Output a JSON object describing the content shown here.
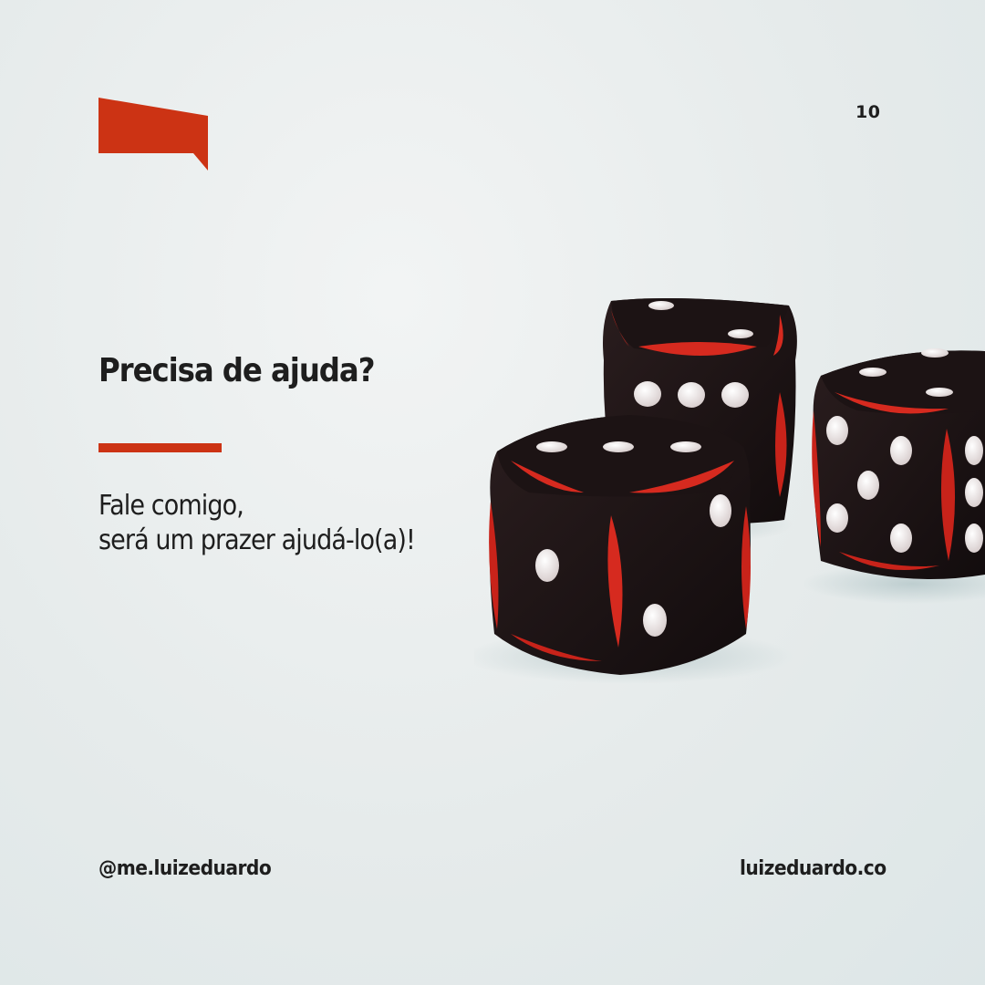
{
  "page_number": "10",
  "headline": "Precisa de ajuda?",
  "body_lines": [
    "Fale comigo,",
    "será um prazer ajudá-lo(a)!"
  ],
  "footer": {
    "handle": "@me.luizeduardo",
    "site": "luizeduardo.co"
  },
  "colors": {
    "accent": "#cc3314",
    "text": "#1e1e1e",
    "background": "#e8eded",
    "dice_body": "#1a1213",
    "dice_red": "#d62a1f",
    "pip": "#f3eeee"
  },
  "icons": {
    "logo": "speech-flag-icon"
  },
  "photo": {
    "subject": "dice",
    "count": 3
  }
}
